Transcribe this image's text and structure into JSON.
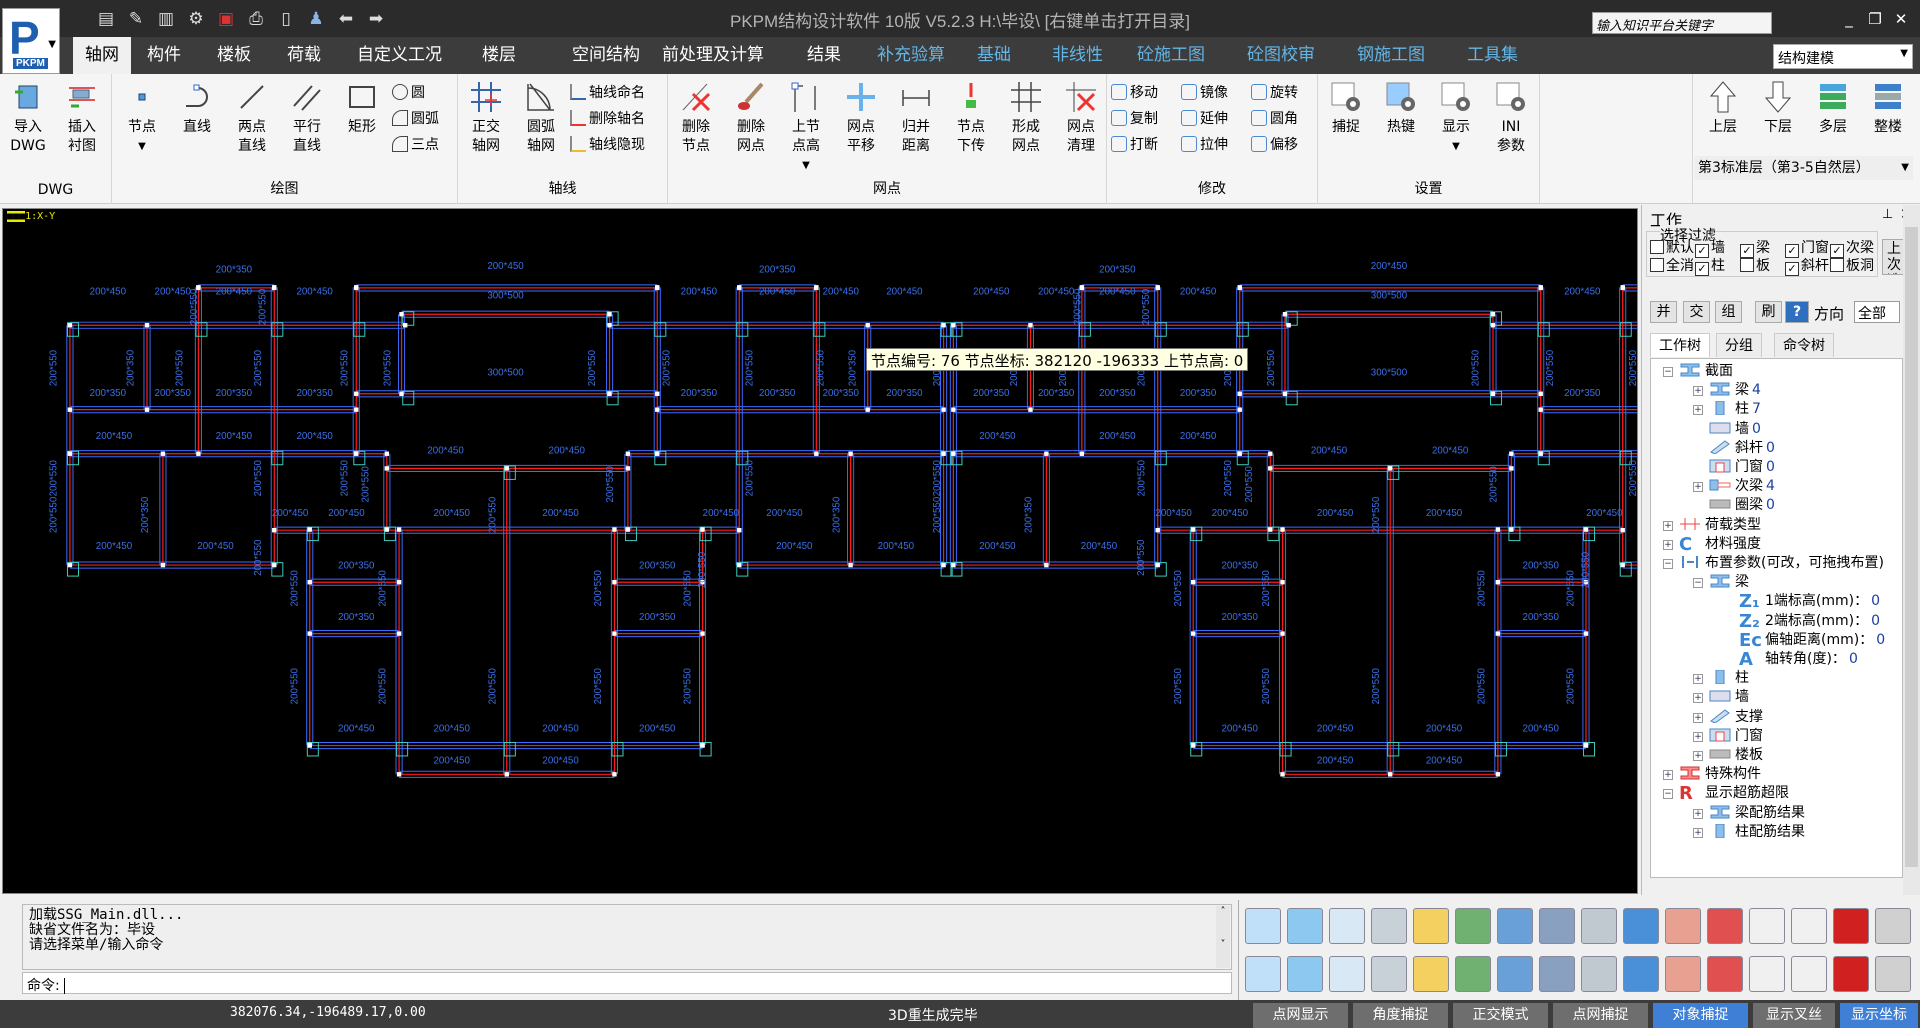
{
  "app": {
    "title": "PKPM结构设计软件 10版 V5.2.3 H:\\毕设\\  [右键单击打开目录]",
    "logo_text": "PKPM",
    "search_placeholder": "输入知识平台关键字",
    "mode": "结构建模"
  },
  "quick_access": [
    "save-icon",
    "save-as-icon",
    "save-copy-icon",
    "plot-icon",
    "dwg-icon",
    "print-icon",
    "help-book-icon",
    "user-icon",
    "undo-arrow-icon",
    "redo-arrow-icon"
  ],
  "tabs": [
    {
      "label": "轴网",
      "active": true
    },
    {
      "label": "构件"
    },
    {
      "label": "楼板"
    },
    {
      "label": "荷载"
    },
    {
      "label": "自定义工况"
    },
    {
      "label": "楼层"
    },
    {
      "label": "空间结构"
    },
    {
      "label": "前处理及计算"
    },
    {
      "label": "结果"
    },
    {
      "label": "补充验算",
      "blue": true
    },
    {
      "label": "基础",
      "blue": true
    },
    {
      "label": "非线性",
      "blue": true
    },
    {
      "label": "砼施工图",
      "blue": true
    },
    {
      "label": "砼图校审",
      "blue": true
    },
    {
      "label": "钢施工图",
      "blue": true
    },
    {
      "label": "工具集",
      "blue": true
    }
  ],
  "ribbon": {
    "dwg": {
      "label": "DWG",
      "buttons": [
        [
          "导入",
          "DWG"
        ],
        [
          "插入",
          "衬图"
        ]
      ]
    },
    "draw": {
      "label": "绘图",
      "buttons": [
        [
          "节点",
          ""
        ],
        [
          "直线",
          ""
        ],
        [
          "两点",
          "直线"
        ],
        [
          "平行",
          "直线"
        ],
        [
          "矩形",
          ""
        ]
      ],
      "small": [
        "圆",
        "圆弧",
        "三点"
      ]
    },
    "axis": {
      "label": "轴线",
      "buttons": [
        [
          "正交",
          "轴网"
        ],
        [
          "圆弧",
          "轴网"
        ]
      ],
      "small": [
        "轴线命名",
        "删除轴名",
        "轴线隐现"
      ]
    },
    "grid": {
      "label": "网点",
      "buttons": [
        [
          "删除",
          "节点"
        ],
        [
          "删除",
          "网点"
        ],
        [
          "上节",
          "点高"
        ],
        [
          "网点",
          "平移"
        ],
        [
          "归并",
          "距离"
        ],
        [
          "节点",
          "下传"
        ],
        [
          "形成",
          "网点"
        ],
        [
          "网点",
          "清理"
        ]
      ]
    },
    "modify": {
      "label": "修改",
      "small": [
        "移动",
        "复制",
        "打断",
        "镜像",
        "延伸",
        "拉伸",
        "旋转",
        "圆角",
        "偏移"
      ]
    },
    "settings": {
      "label": "设置",
      "buttons": [
        [
          "捕捉",
          ""
        ],
        [
          "热键",
          ""
        ],
        [
          "显示",
          ""
        ],
        [
          "INI",
          "参数"
        ]
      ]
    },
    "floor": {
      "buttons": [
        "上层",
        "下层",
        "多层",
        "整楼"
      ],
      "current": "第3标准层（第3-5自然层）"
    }
  },
  "canvas": {
    "view_label": "1:X-Y",
    "beam_labels": [
      "200*350",
      "200*450",
      "300*500",
      "200*550"
    ],
    "tooltip": "节点编号: 76 节点坐标: 382120 -196333 上节点高: 0"
  },
  "panel": {
    "title": "工作",
    "filter_title": "选择过滤",
    "filters": [
      {
        "label": "默认",
        "checked": false
      },
      {
        "label": "墙",
        "checked": true
      },
      {
        "label": "梁",
        "checked": true
      },
      {
        "label": "门窗",
        "checked": true
      },
      {
        "label": "次梁",
        "checked": true
      },
      {
        "label": "全消",
        "checked": false
      },
      {
        "label": "柱",
        "checked": true
      },
      {
        "label": "板",
        "checked": false
      },
      {
        "label": "斜杆",
        "checked": true
      },
      {
        "label": "板洞",
        "checked": false
      }
    ],
    "last_select": "上次选择",
    "ops": [
      "并",
      "交",
      "组",
      "刷"
    ],
    "direction_label": "方向",
    "direction": "全部",
    "tabs": [
      "工作树",
      "分组",
      "命令树"
    ],
    "tree": [
      {
        "l": 0,
        "e": "-",
        "i": "beam",
        "t": "截面",
        "v": ""
      },
      {
        "l": 1,
        "e": "+",
        "i": "beam",
        "t": "梁",
        "v": "4"
      },
      {
        "l": 1,
        "e": "+",
        "i": "column",
        "t": "柱",
        "v": "7"
      },
      {
        "l": 1,
        "e": "",
        "i": "wall",
        "t": "墙",
        "v": "0"
      },
      {
        "l": 1,
        "e": "",
        "i": "brace",
        "t": "斜杆",
        "v": "0"
      },
      {
        "l": 1,
        "e": "",
        "i": "window",
        "t": "门窗",
        "v": "0"
      },
      {
        "l": 1,
        "e": "+",
        "i": "secbeam",
        "t": "次梁",
        "v": "4"
      },
      {
        "l": 1,
        "e": "",
        "i": "ring",
        "t": "圈梁",
        "v": "0"
      },
      {
        "l": 0,
        "e": "+",
        "i": "load",
        "t": "荷载类型",
        "v": ""
      },
      {
        "l": 0,
        "e": "+",
        "i": "C",
        "t": "材料强度",
        "v": ""
      },
      {
        "l": 0,
        "e": "-",
        "i": "place",
        "t": "布置参数(可改，可拖拽布置)",
        "v": ""
      },
      {
        "l": 1,
        "e": "-",
        "i": "beam",
        "t": "梁",
        "v": ""
      },
      {
        "l": 2,
        "e": "",
        "i": "Z1",
        "t": "1端标高(mm)：",
        "v": "0"
      },
      {
        "l": 2,
        "e": "",
        "i": "Z2",
        "t": "2端标高(mm)：",
        "v": "0"
      },
      {
        "l": 2,
        "e": "",
        "i": "Ec",
        "t": "偏轴距离(mm)：",
        "v": "0"
      },
      {
        "l": 2,
        "e": "",
        "i": "A",
        "t": "轴转角(度)：",
        "v": "0"
      },
      {
        "l": 1,
        "e": "+",
        "i": "column",
        "t": "柱",
        "v": ""
      },
      {
        "l": 1,
        "e": "+",
        "i": "wall",
        "t": "墙",
        "v": ""
      },
      {
        "l": 1,
        "e": "+",
        "i": "brace",
        "t": "支撑",
        "v": ""
      },
      {
        "l": 1,
        "e": "+",
        "i": "window",
        "t": "门窗",
        "v": ""
      },
      {
        "l": 1,
        "e": "+",
        "i": "ring",
        "t": "楼板",
        "v": ""
      },
      {
        "l": 0,
        "e": "+",
        "i": "special",
        "t": "特殊构件",
        "v": ""
      },
      {
        "l": 0,
        "e": "-",
        "i": "R",
        "t": "显示超筋超限",
        "v": ""
      },
      {
        "l": 1,
        "e": "+",
        "i": "beam",
        "t": "梁配筋结果",
        "v": ""
      },
      {
        "l": 1,
        "e": "+",
        "i": "column",
        "t": "柱配筋结果",
        "v": ""
      }
    ]
  },
  "command": {
    "log": [
      "加载SSG_Main.dll...",
      "缺省文件名为：毕设",
      "请选择菜单/输入命令"
    ],
    "prompt": "命令:",
    "value": ""
  },
  "toolbar_icons": [
    "view-plan-icon",
    "view-front-icon",
    "view-side-icon",
    "view-3d-icon",
    "light-icon",
    "light-color-icon",
    "frame-icon",
    "grid-icon",
    "orbit-icon",
    "zoom-fit-icon",
    "layer-icon",
    "delete-layer-icon",
    "font-larger-icon",
    "font-smaller-icon",
    "dwg-export-icon",
    "ruler-icon",
    "arrow-left-icon",
    "arrow-right-icon",
    "delete-view-icon",
    "zoom-icon",
    "zoom-window-icon",
    "zoom-in-icon",
    "zoom-out-icon",
    "zoom-prev-icon",
    "bulb-icon",
    "stack-icon",
    "query-icon",
    "model-icon",
    "floors-icon",
    "building-icon",
    "section-icon",
    "list-icon"
  ],
  "status": {
    "coords": "382076.34,-196489.17,0.00",
    "message": "3D重生成完毕",
    "buttons": [
      {
        "label": "点网显示",
        "on": false
      },
      {
        "label": "角度捕捉",
        "on": false
      },
      {
        "label": "正交模式",
        "on": false
      },
      {
        "label": "点网捕捉",
        "on": false
      },
      {
        "label": "对象捕捉",
        "on": true
      },
      {
        "label": "显示叉丝",
        "on": false
      },
      {
        "label": "显示坐标",
        "on": true
      }
    ]
  },
  "colors": {
    "accent_tab": "#62b6e8",
    "beam_red": "#ff1a1a",
    "beam_blue": "#3b6cff",
    "column_cyan": "#3fd0c0",
    "status_on": "#3f7fd6"
  }
}
